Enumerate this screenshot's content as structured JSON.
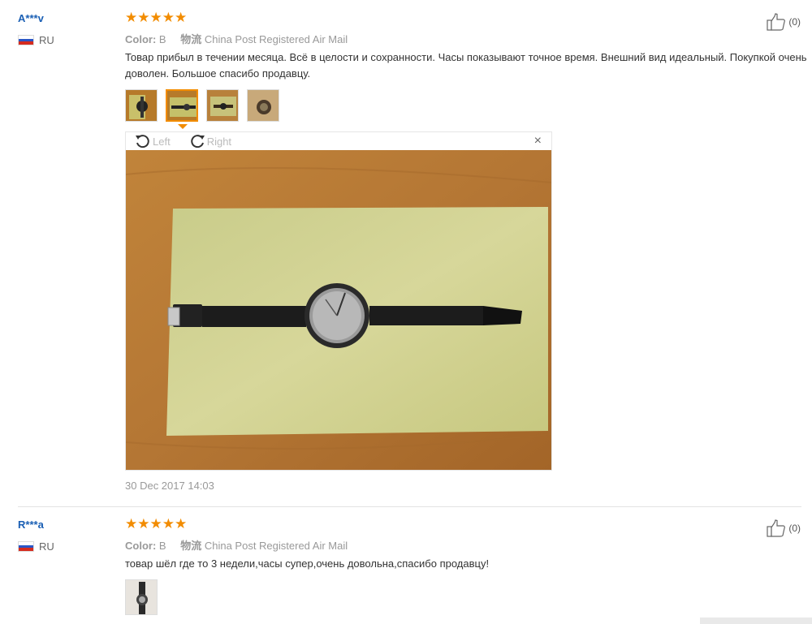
{
  "reviews": [
    {
      "user": "A***v",
      "country": "RU",
      "rating": 5,
      "color_label": "Color:",
      "color_value": "B",
      "shipping_label": "物流",
      "shipping_value": "China Post Registered Air Mail",
      "text": "Товар прибыл в течении месяца. Всё в целости и сохранности. Часы показывают точное время. Внешний вид идеальный. Покупкой очень доволен. Большое спасибо продавцу.",
      "likes": "(0)",
      "date": "30 Dec 2017 14:03",
      "viewer": {
        "rotate_left": "Left",
        "rotate_right": "Right",
        "close": "×"
      }
    },
    {
      "user": "R***a",
      "country": "RU",
      "rating": 5,
      "color_label": "Color:",
      "color_value": "B",
      "shipping_label": "物流",
      "shipping_value": "China Post Registered Air Mail",
      "text": "товар шёл где то 3 недели,часы супер,очень довольна,спасибо продавцу!",
      "likes": "(0)"
    }
  ],
  "colors": {
    "accent": "#f28c00",
    "link": "#1a5fb4",
    "muted": "#999999"
  },
  "icons": [
    "star-icon",
    "thumbs-up-icon",
    "russia-flag-icon",
    "rotate-left-icon",
    "rotate-right-icon",
    "close-icon"
  ]
}
